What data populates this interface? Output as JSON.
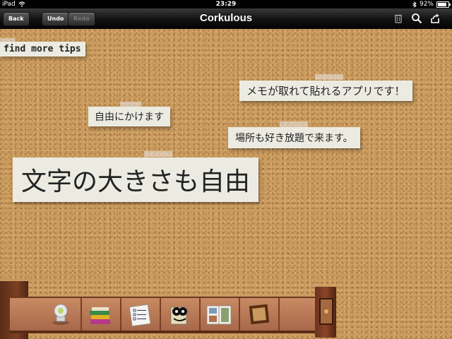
{
  "status_bar": {
    "device": "iPad",
    "time": "23:29",
    "battery": "92%"
  },
  "nav_bar": {
    "title": "Corkulous",
    "back_label": "Back",
    "undo_label": "Undo",
    "redo_label": "Redo"
  },
  "board": {
    "tip_label": "find more tips",
    "notes": [
      "メモが取れて貼れるアプリです！",
      "自由にかけます",
      "場所も好き放題で来ます。",
      "文字の大きさも自由"
    ]
  },
  "shelf": {
    "items": [
      "pushpin-tool",
      "books-tool",
      "checklist-tool",
      "character-tool",
      "photo-album-tool",
      "cork-frame-tool"
    ]
  },
  "colors": {
    "cork": "#c99a5e",
    "note_paper": "#ecebe2",
    "shelf_wood": "#a8684a"
  }
}
